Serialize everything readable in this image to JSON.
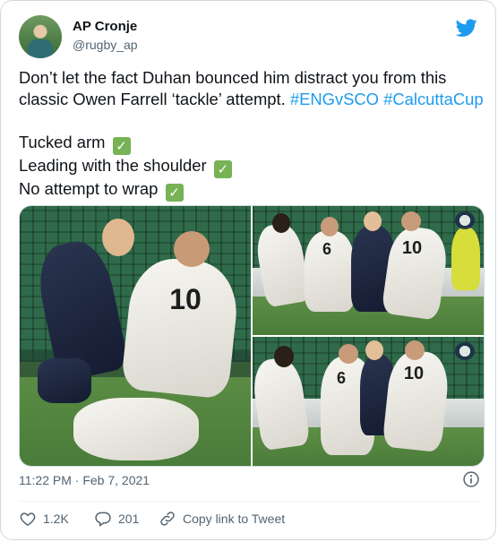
{
  "author": {
    "name": "AP Cronje",
    "handle": "@rugby_ap",
    "avatar_icon": "avatar"
  },
  "tweet": {
    "line1_text": "Don’t let the fact Duhan bounced him distract you from this classic Owen Farrell ‘tackle’ attempt. ",
    "hashtag1": "#ENGvSCO",
    "hashtag2": "#CalcuttaCup",
    "list": [
      "Tucked arm",
      "Leading with the shoulder",
      "No attempt to wrap"
    ],
    "check_glyph": "✓"
  },
  "media": {
    "left_number": "10",
    "tr_numbers": [
      "6",
      "10"
    ],
    "br_numbers": [
      "6",
      "10"
    ]
  },
  "meta": {
    "time": "11:22 PM",
    "separator": " · ",
    "date": "Feb 7, 2021"
  },
  "actions": {
    "likes": "1.2K",
    "replies": "201",
    "copy_link": "Copy link to Tweet"
  },
  "colors": {
    "accent": "#1d9bf0",
    "like_red": "#f91880",
    "check_green": "#77b255"
  }
}
